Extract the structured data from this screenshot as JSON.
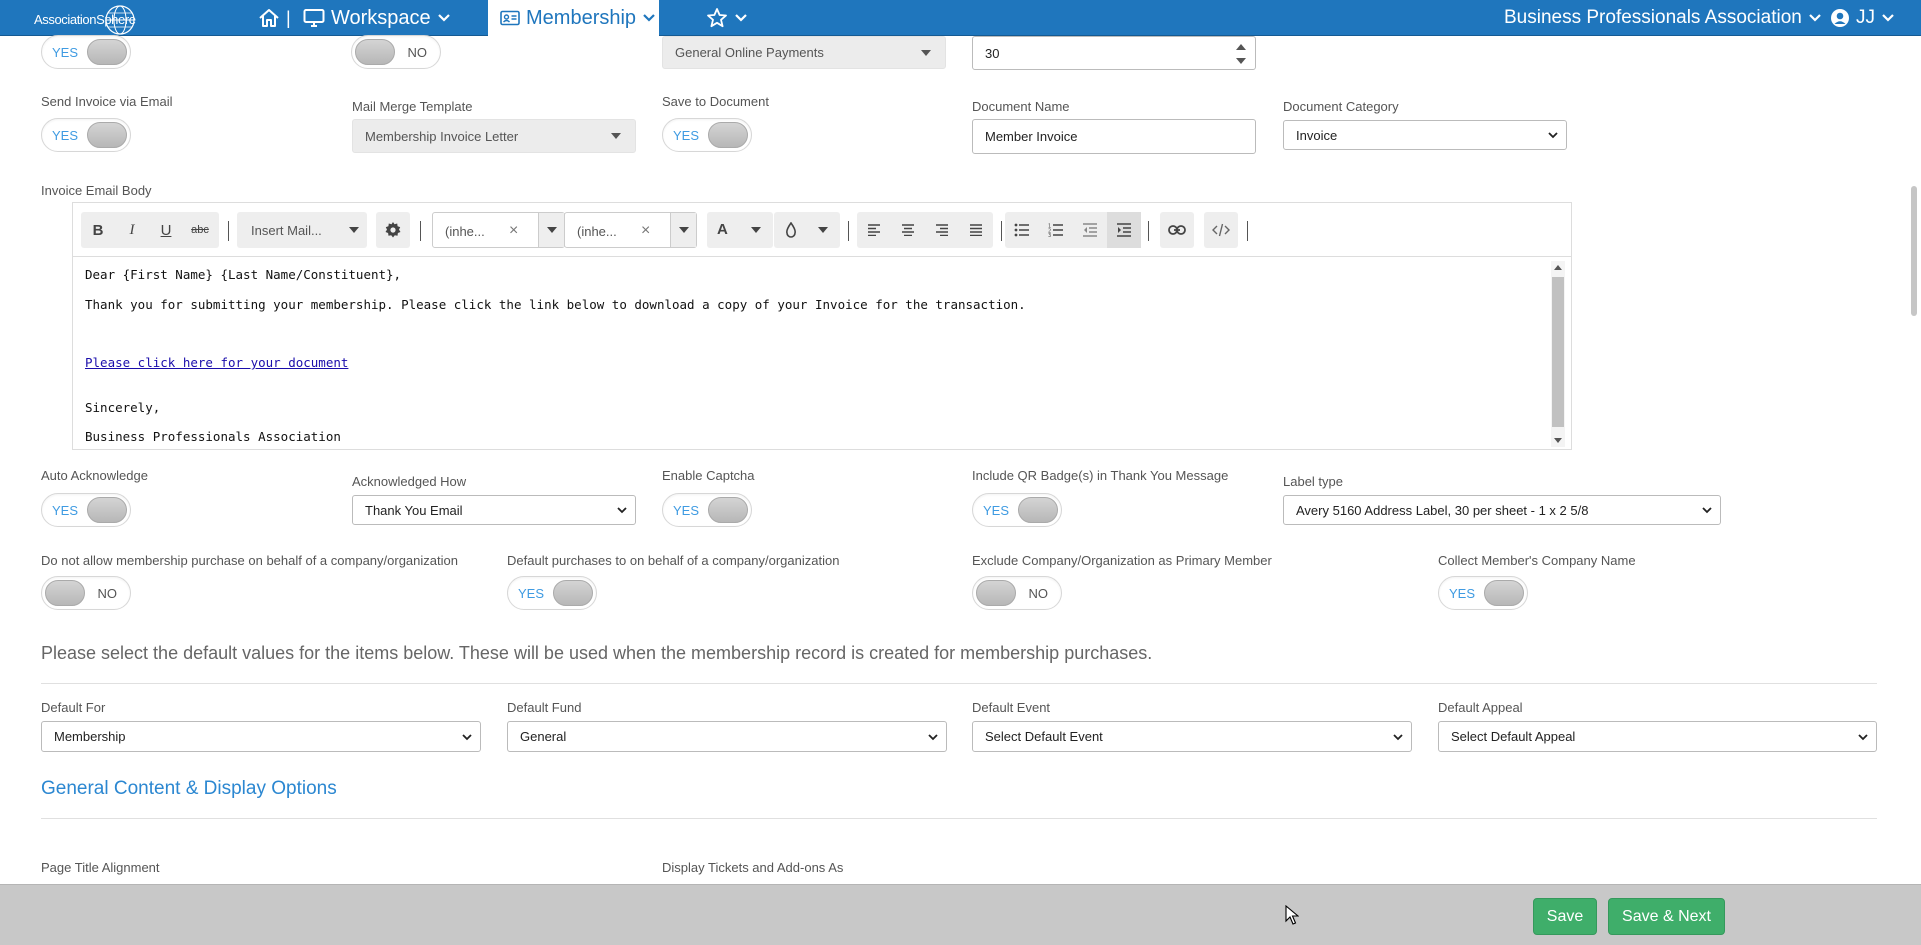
{
  "nav": {
    "brand": "AssociationSphere",
    "workspace": "Workspace",
    "membership": "Membership",
    "organization": "Business Professionals Association",
    "user_initials": "JJ",
    "separator": "|"
  },
  "top_partial": {
    "toggle1": "YES",
    "toggle2": "NO",
    "payment_select": "General Online Payments",
    "number_value": "30"
  },
  "invoice": {
    "send_invoice_label": "Send Invoice via Email",
    "send_invoice_toggle": "YES",
    "mail_merge_label": "Mail Merge Template",
    "mail_merge_value": "Membership Invoice Letter",
    "save_doc_label": "Save to Document",
    "save_doc_toggle": "YES",
    "doc_name_label": "Document Name",
    "doc_name_value": "Member Invoice",
    "doc_category_label": "Document Category",
    "doc_category_value": "Invoice"
  },
  "editor": {
    "label": "Invoice Email Body",
    "insert_mail": "Insert Mail...",
    "font_family": "(inhe...",
    "font_size": "(inhe...",
    "lines": {
      "greeting": "Dear {First Name} {Last Name/Constituent},",
      "body": "Thank you for submitting your membership. Please click the link below to download a copy of your Invoice for the transaction.",
      "link": "Please click here for your document",
      "closing": "Sincerely,",
      "signature": "Business Professionals Association"
    }
  },
  "ack": {
    "auto_ack_label": "Auto Acknowledge",
    "auto_ack_toggle": "YES",
    "ack_how_label": "Acknowledged How",
    "ack_how_value": "Thank You Email",
    "captcha_label": "Enable Captcha",
    "captcha_toggle": "YES",
    "qr_label": "Include QR Badge(s) in Thank You Message",
    "qr_toggle": "YES",
    "label_type_label": "Label type",
    "label_type_value": "Avery 5160 Address Label, 30 per sheet - 1 x 2 5/8"
  },
  "company": {
    "no_behalf_label": "Do not allow membership purchase on behalf of a company/organization",
    "no_behalf_toggle": "NO",
    "default_behalf_label": "Default purchases to on behalf of a company/organization",
    "default_behalf_toggle": "YES",
    "exclude_label": "Exclude Company/Organization as Primary Member",
    "exclude_toggle": "NO",
    "collect_label": "Collect Member's Company Name",
    "collect_toggle": "YES"
  },
  "defaults": {
    "intro": "Please select the default values for the items below. These will be used when the membership record is created for membership purchases.",
    "for_label": "Default For",
    "for_value": "Membership",
    "fund_label": "Default Fund",
    "fund_value": "General",
    "event_label": "Default Event",
    "event_value": "Select Default Event",
    "appeal_label": "Default Appeal",
    "appeal_value": "Select Default Appeal"
  },
  "general": {
    "heading": "General Content & Display Options",
    "title_align_label": "Page Title Alignment",
    "tickets_label": "Display Tickets and Add-ons As"
  },
  "footer": {
    "save": "Save",
    "save_next": "Save & Next"
  },
  "colors": {
    "nav_blue": "#1f76bd",
    "accent_blue": "#2b87d1",
    "toggle_yes": "#3f9be2",
    "save_green": "#3fae6a",
    "footer_gray": "#c8c8c8"
  }
}
